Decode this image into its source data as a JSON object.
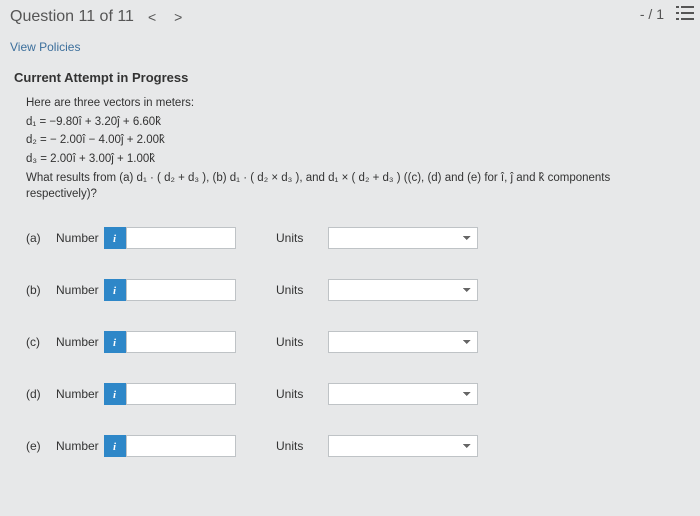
{
  "header": {
    "question_label": "Question 11 of 11",
    "prev": "<",
    "next": ">",
    "score": "- / 1"
  },
  "links": {
    "view_policies": "View Policies"
  },
  "attempt_label": "Current Attempt in Progress",
  "prompt": {
    "intro": "Here are three vectors in meters:",
    "d1": "d₁ = −9.80î + 3.20ĵ + 6.60k̂",
    "d2": "d₂ =  − 2.00î − 4.00ĵ + 2.00k̂",
    "d3": "d₃ = 2.00î + 3.00ĵ + 1.00k̂",
    "ask": "What results from (a) d₁ · ( d₂ + d₃ ), (b) d₁ · ( d₂ × d₃ ), and d₁ × ( d₂ + d₃ ) ((c), (d) and (e) for î, ĵ and k̂ components respectively)?"
  },
  "labels": {
    "number": "Number",
    "units": "Units",
    "info_icon": "i"
  },
  "parts": [
    {
      "id": "a",
      "label": "(a)"
    },
    {
      "id": "b",
      "label": "(b)"
    },
    {
      "id": "c",
      "label": "(c)"
    },
    {
      "id": "d",
      "label": "(d)"
    },
    {
      "id": "e",
      "label": "(e)"
    }
  ]
}
